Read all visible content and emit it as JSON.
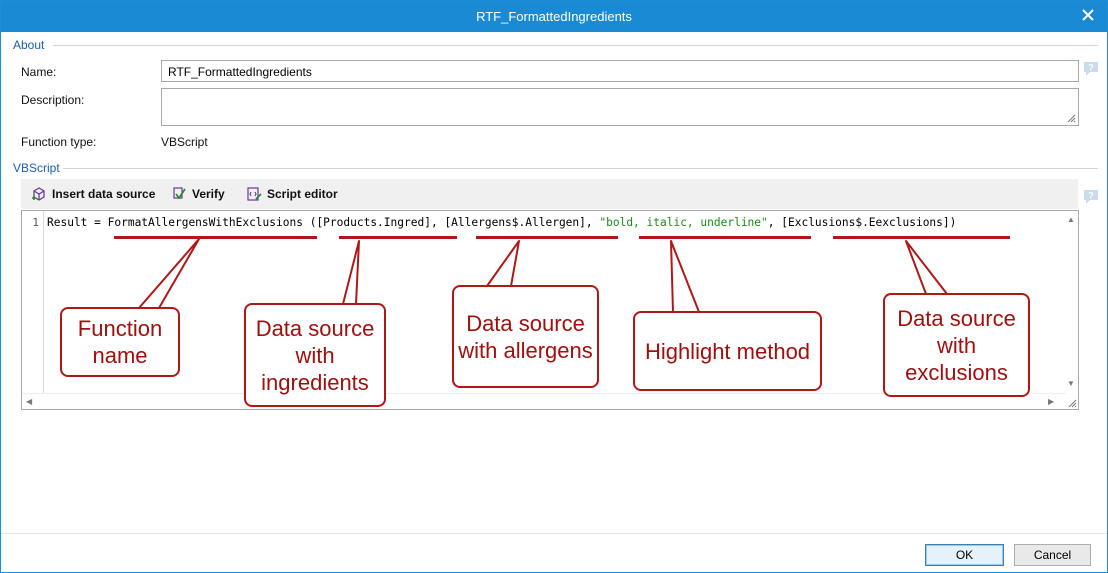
{
  "window": {
    "title": "RTF_FormattedIngredients",
    "close_icon": "close-icon"
  },
  "about": {
    "section_label": "About",
    "name_label": "Name:",
    "name_value": "RTF_FormattedIngredients",
    "description_label": "Description:",
    "description_value": "",
    "function_type_label": "Function type:",
    "function_type_value": "VBScript"
  },
  "vbscript": {
    "section_label": "VBScript",
    "toolbar": {
      "insert_label": "Insert data source",
      "verify_label": "Verify",
      "editor_label": "Script editor"
    },
    "editor": {
      "line_number": "1",
      "code_prefix": "Result = ",
      "function_name": "FormatAllergensWithExclusions",
      "open": " (",
      "arg1": "[Products.Ingred]",
      "sep1": ", ",
      "arg2": "[Allergens$.Allergen]",
      "sep2": ", ",
      "arg3": "\"bold, italic, underline\"",
      "sep3": ", ",
      "arg4": "[Exclusions$.Eexclusions]",
      "close": ")"
    }
  },
  "callouts": {
    "function_name": "Function name",
    "ingredients": "Data source with ingredients",
    "allergens": "Data source with allergens",
    "highlight": "Highlight method",
    "exclusions": "Data source with exclusions"
  },
  "footer": {
    "ok_label": "OK",
    "cancel_label": "Cancel"
  },
  "colors": {
    "title_bar": "#1a8ad4",
    "annotation": "#b01818",
    "section_heading": "#1a5fa8"
  }
}
